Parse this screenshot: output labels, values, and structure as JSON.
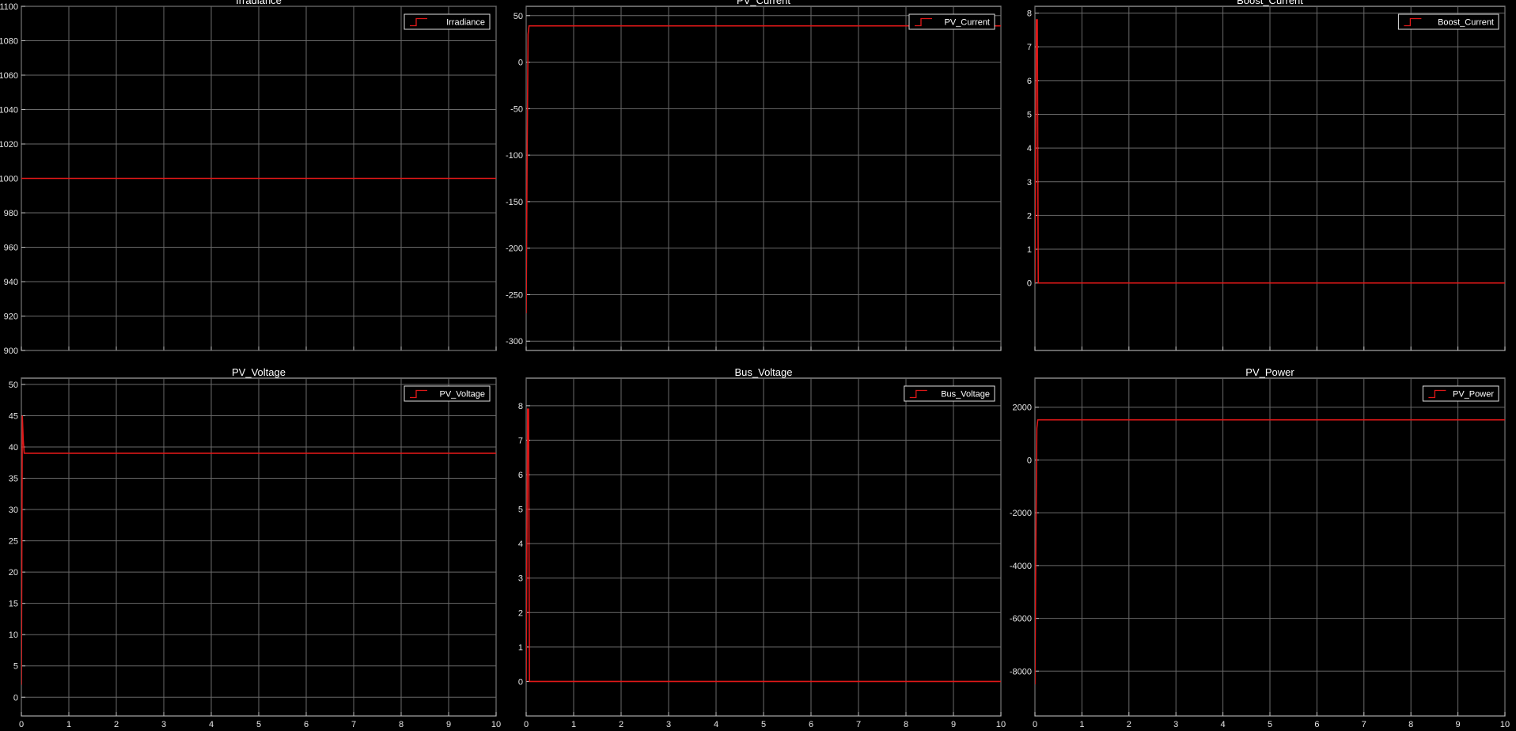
{
  "figure": {
    "background": "#000000",
    "axes_color": "#000000",
    "grid_color": "#6a6a6a",
    "text_color": "#e6e6e6",
    "line_color": "#e01818"
  },
  "chart_data": [
    {
      "type": "line",
      "title": "Irradiance",
      "xlabel": "",
      "ylabel": "",
      "xlim": [
        0,
        10
      ],
      "ylim": [
        900,
        1100
      ],
      "xticks": [
        0,
        1,
        2,
        3,
        4,
        5,
        6,
        7,
        8,
        9,
        10
      ],
      "yticks": [
        900,
        920,
        940,
        960,
        980,
        1000,
        1020,
        1040,
        1060,
        1080,
        1100
      ],
      "show_xtick_labels": false,
      "grid": true,
      "legend_position": "top-right",
      "series": [
        {
          "name": "Irradiance",
          "color": "#e01818",
          "x": [
            0,
            10
          ],
          "y": [
            1000,
            1000
          ]
        }
      ]
    },
    {
      "type": "line",
      "title": "PV_Current",
      "xlabel": "",
      "ylabel": "",
      "xlim": [
        0,
        10
      ],
      "ylim": [
        -310,
        60
      ],
      "xticks": [
        0,
        1,
        2,
        3,
        4,
        5,
        6,
        7,
        8,
        9,
        10
      ],
      "yticks": [
        -300,
        -250,
        -200,
        -150,
        -100,
        -50,
        0,
        50
      ],
      "show_xtick_labels": false,
      "grid": true,
      "legend_position": "top-right",
      "series": [
        {
          "name": "PV_Current",
          "color": "#e01818",
          "x": [
            0,
            0.02,
            0.04,
            0.06,
            10
          ],
          "y": [
            -270,
            -100,
            30,
            39,
            39
          ]
        }
      ]
    },
    {
      "type": "line",
      "title": "Boost_Current",
      "xlabel": "",
      "ylabel": "",
      "xlim": [
        0,
        10
      ],
      "ylim": [
        -2,
        8.2
      ],
      "xticks": [
        0,
        1,
        2,
        3,
        4,
        5,
        6,
        7,
        8,
        9,
        10
      ],
      "yticks": [
        0,
        1,
        2,
        3,
        4,
        5,
        6,
        7,
        8
      ],
      "show_xtick_labels": false,
      "grid": true,
      "legend_position": "top-right",
      "series": [
        {
          "name": "Boost_Current",
          "color": "#e01818",
          "x": [
            0,
            0.03,
            0.05,
            0.07,
            10
          ],
          "y": [
            0,
            7.8,
            7.8,
            0,
            0
          ]
        }
      ]
    },
    {
      "type": "line",
      "title": "PV_Voltage",
      "xlabel": "",
      "ylabel": "",
      "xlim": [
        0,
        10
      ],
      "ylim": [
        -3,
        51
      ],
      "xticks": [
        0,
        1,
        2,
        3,
        4,
        5,
        6,
        7,
        8,
        9,
        10
      ],
      "yticks": [
        0,
        5,
        10,
        15,
        20,
        25,
        30,
        35,
        40,
        45,
        50
      ],
      "show_xtick_labels": true,
      "grid": true,
      "legend_position": "top-right",
      "series": [
        {
          "name": "PV_Voltage",
          "color": "#e01818",
          "x": [
            0,
            0.02,
            0.04,
            0.06,
            10
          ],
          "y": [
            2,
            45,
            41,
            39,
            39
          ]
        }
      ]
    },
    {
      "type": "line",
      "title": "Bus_Voltage",
      "xlabel": "",
      "ylabel": "",
      "xlim": [
        0,
        10
      ],
      "ylim": [
        -1,
        8.8
      ],
      "xticks": [
        0,
        1,
        2,
        3,
        4,
        5,
        6,
        7,
        8,
        9,
        10
      ],
      "yticks": [
        0,
        1,
        2,
        3,
        4,
        5,
        6,
        7,
        8
      ],
      "show_xtick_labels": true,
      "grid": true,
      "legend_position": "top-right",
      "series": [
        {
          "name": "Bus_Voltage",
          "color": "#e01818",
          "x": [
            0,
            0.03,
            0.05,
            0.07,
            10
          ],
          "y": [
            0,
            7.9,
            7.9,
            0,
            0
          ]
        }
      ]
    },
    {
      "type": "line",
      "title": "PV_Power",
      "xlabel": "",
      "ylabel": "",
      "xlim": [
        0,
        10
      ],
      "ylim": [
        -9700,
        3100
      ],
      "xticks": [
        0,
        1,
        2,
        3,
        4,
        5,
        6,
        7,
        8,
        9,
        10
      ],
      "yticks": [
        -8000,
        -6000,
        -4000,
        -2000,
        0,
        2000
      ],
      "show_xtick_labels": true,
      "grid": true,
      "legend_position": "top-right",
      "series": [
        {
          "name": "PV_Power",
          "color": "#e01818",
          "x": [
            0,
            0.02,
            0.04,
            0.06,
            10
          ],
          "y": [
            -8500,
            -3000,
            1200,
            1520,
            1520
          ]
        }
      ]
    }
  ]
}
